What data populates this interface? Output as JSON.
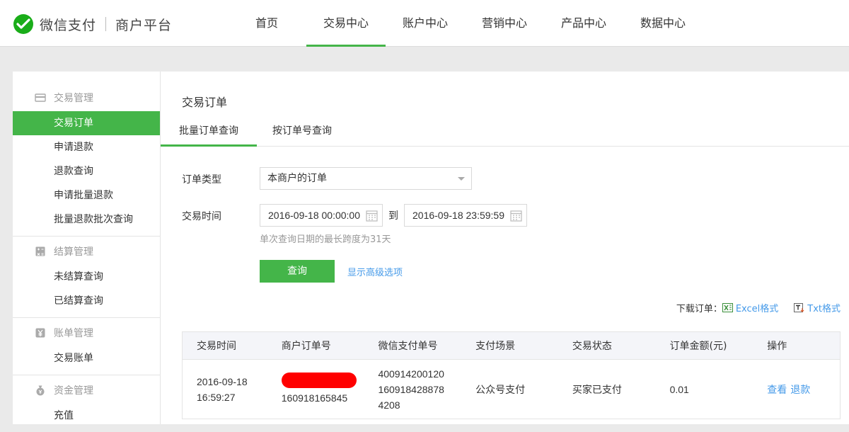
{
  "header": {
    "brand_name": "微信支付",
    "brand_sub": "商户平台",
    "nav": [
      {
        "label": "首页"
      },
      {
        "label": "交易中心",
        "active": true
      },
      {
        "label": "账户中心"
      },
      {
        "label": "营销中心"
      },
      {
        "label": "产品中心"
      },
      {
        "label": "数据中心"
      }
    ]
  },
  "sidebar": {
    "groups": [
      {
        "title": "交易管理",
        "icon": "card-icon",
        "items": [
          "交易订单",
          "申请退款",
          "退款查询",
          "申请批量退款",
          "批量退款批次查询"
        ]
      },
      {
        "title": "结算管理",
        "icon": "calculator-icon",
        "items": [
          "未结算查询",
          "已结算查询"
        ]
      },
      {
        "title": "账单管理",
        "icon": "yen-icon",
        "items": [
          "交易账单"
        ]
      },
      {
        "title": "资金管理",
        "icon": "money-bag-icon",
        "items": [
          "充值"
        ]
      }
    ],
    "active_item": "交易订单"
  },
  "main": {
    "title": "交易订单",
    "tabs": [
      {
        "label": "批量订单查询",
        "active": true
      },
      {
        "label": "按订单号查询"
      }
    ],
    "form": {
      "order_type_label": "订单类型",
      "order_type_value": "本商户的订单",
      "time_label": "交易时间",
      "start_time": "2016-09-18 00:00:00",
      "to_label": "到",
      "end_time": "2016-09-18 23:59:59",
      "hint": "单次查询日期的最长跨度为31天",
      "query_button": "查询",
      "advanced_link": "显示高级选项"
    },
    "download": {
      "label": "下载订单：",
      "excel": "Excel格式",
      "txt": "Txt格式"
    },
    "table": {
      "headers": [
        "交易时间",
        "商户订单号",
        "微信支付单号",
        "支付场景",
        "交易状态",
        "订单金额(元)",
        "操作"
      ],
      "rows": [
        {
          "time_date": "2016-09-18",
          "time_clock": "16:59:27",
          "merchant_order_no": "160918165845",
          "wx_no_line1": "400914200120",
          "wx_no_line2": "160918428878",
          "wx_no_line3": "4208",
          "scene": "公众号支付",
          "status": "买家已支付",
          "amount": "0.01",
          "op_view": "查看",
          "op_refund": "退款"
        }
      ]
    }
  },
  "colors": {
    "accent_green": "#44b549",
    "link_blue": "#459ae9",
    "redaction": "#ff0000"
  }
}
